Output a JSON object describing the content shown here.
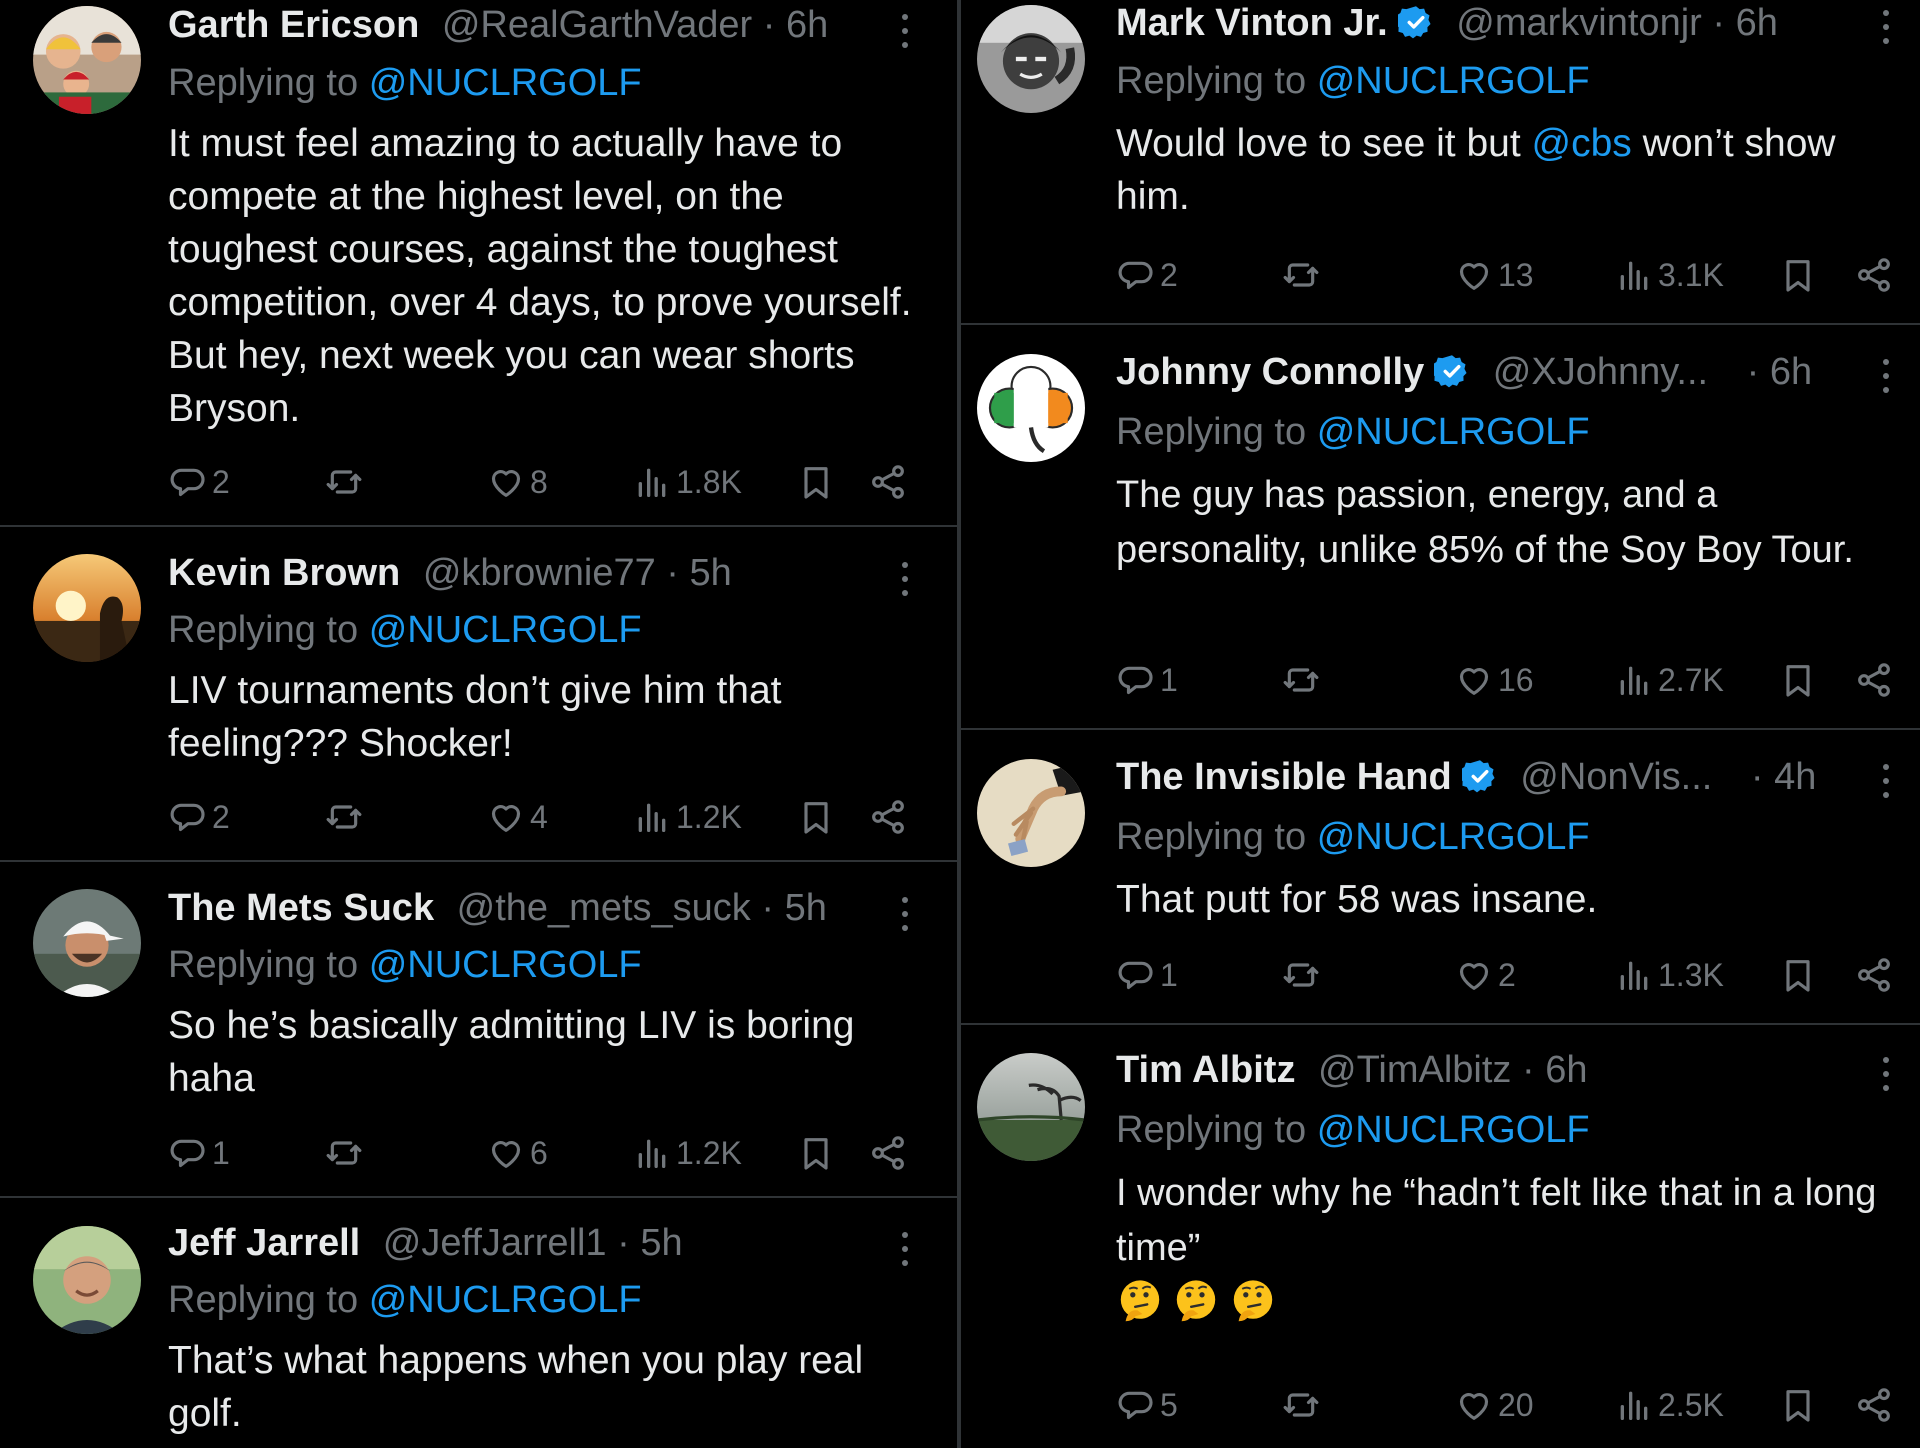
{
  "replying_label": "Replying to",
  "left_tweets": [
    {
      "name": "Garth Ericson",
      "handle": "@RealGarthVader",
      "dot": "·",
      "time": "6h",
      "replying_to": "@NUCLRGOLF",
      "text": "It must feel amazing to actually have to compete at the highest level, on the toughest courses, against the toughest competition, over 4 days, to prove yourself. But hey, next week you can wear shorts Bryson.",
      "replies": "2",
      "likes": "8",
      "views": "1.8K"
    },
    {
      "name": "Kevin Brown",
      "handle": "@kbrownie77",
      "dot": "·",
      "time": "5h",
      "replying_to": "@NUCLRGOLF",
      "text": "LIV tournaments don’t give him that feeling??? Shocker!",
      "replies": "2",
      "likes": "4",
      "views": "1.2K"
    },
    {
      "name": "The Mets Suck",
      "handle": "@the_mets_suck",
      "dot": "·",
      "time": "5h",
      "replying_to": "@NUCLRGOLF",
      "text": "So he’s basically admitting LIV is boring haha",
      "replies": "1",
      "likes": "6",
      "views": "1.2K"
    },
    {
      "name": "Jeff Jarrell",
      "handle": "@JeffJarrell1",
      "dot": "·",
      "time": "5h",
      "replying_to": "@NUCLRGOLF",
      "text": "That’s what happens when you play real golf."
    }
  ],
  "right_tweets": [
    {
      "name": "Mark Vinton Jr.",
      "verified": true,
      "handle": "@markvintonjr",
      "dot": "·",
      "time": "6h",
      "replying_to": "@NUCLRGOLF",
      "text_before": "Would love to see it but ",
      "text_mention": "@cbs",
      "text_after": " won’t show him.",
      "replies": "2",
      "likes": "13",
      "views": "3.1K"
    },
    {
      "name": "Johnny Connolly",
      "verified": true,
      "handle": "@XJohnny...",
      "dot": "·",
      "time": "6h",
      "replying_to": "@NUCLRGOLF",
      "text": "The guy has passion, energy, and a personality, unlike 85% of the Soy Boy Tour.",
      "replies": "1",
      "likes": "16",
      "views": "2.7K"
    },
    {
      "name": "The Invisible Hand",
      "verified": true,
      "handle": "@NonVis...",
      "dot": "·",
      "time": "4h",
      "replying_to": "@NUCLRGOLF",
      "text": "That putt for 58 was insane.",
      "replies": "1",
      "likes": "2",
      "views": "1.3K"
    },
    {
      "name": "Tim Albitz",
      "handle": "@TimAlbitz",
      "dot": "·",
      "time": "6h",
      "replying_to": "@NUCLRGOLF",
      "text": "I wonder why he “hadn’t felt like that in a long time”",
      "emoji_name": "thinking-face",
      "emoji_count": 3,
      "replies": "5",
      "likes": "20",
      "views": "2.5K"
    }
  ],
  "icons": {
    "reply": "reply-icon",
    "retweet": "retweet-icon",
    "like": "like-icon",
    "views": "views-icon",
    "bookmark": "bookmark-icon",
    "share": "share-icon",
    "verified": "verified-badge-icon",
    "more": "more-options-icon"
  },
  "colors": {
    "background": "#000000",
    "text": "#e7e9ea",
    "secondary": "#71767b",
    "accent": "#1d9bf0",
    "divider": "#2f3336"
  }
}
